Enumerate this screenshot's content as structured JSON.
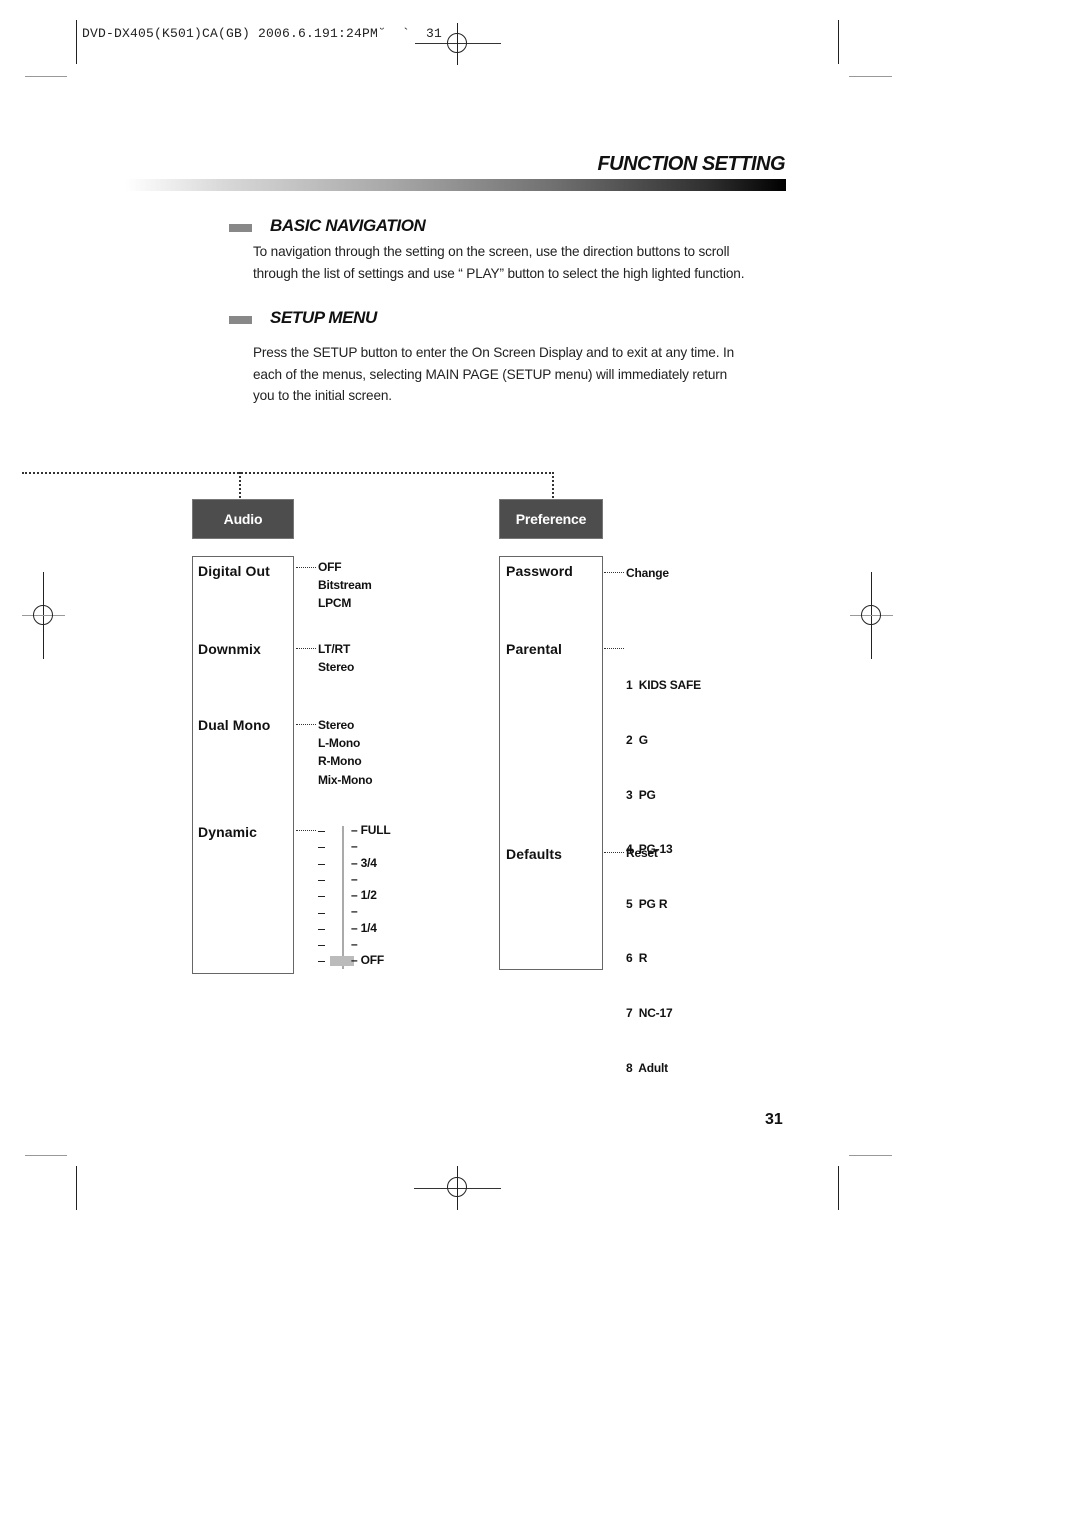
{
  "slug_line": "DVD-DX405(K501)CA(GB) 2006.6.191:24PM˘  `  31",
  "page_title": "FUNCTION SETTING",
  "sections": [
    {
      "title": "BASIC NAVIGATION",
      "lines": [
        "To navigation through the setting on the screen, use the direction buttons to scroll",
        "through the list of settings and use “ PLAY”  button to select the high lighted function."
      ]
    },
    {
      "title": "SETUP MENU",
      "lines": [
        "Press the SETUP button to enter the On Screen Display and to exit at any time. In",
        "each of the menus, selecting MAIN PAGE (SETUP menu) will immediately return",
        "you to the initial screen."
      ]
    }
  ],
  "diagram": {
    "audio": {
      "label": "Audio",
      "items": [
        {
          "label": "Digital Out",
          "options": [
            "OFF",
            "Bitstream",
            "LPCM"
          ]
        },
        {
          "label": "Downmix",
          "options": [
            "LT/RT",
            "Stereo"
          ]
        },
        {
          "label": "Dual Mono",
          "options": [
            "Stereo",
            "L-Mono",
            "R-Mono",
            "Mix-Mono"
          ]
        },
        {
          "label": "Dynamic",
          "slider": {
            "levels": [
              "– FULL",
              "–",
              "– 3/4",
              "–",
              "– 1/2",
              "–",
              "– 1/4",
              "–",
              "– OFF"
            ],
            "current": "OFF",
            "current_fraction": 0
          }
        }
      ]
    },
    "preference": {
      "label": "Preference",
      "items": [
        {
          "label": "Password",
          "options": [
            "Change"
          ]
        },
        {
          "label": "Parental",
          "options": [
            "1  KIDS SAFE",
            "2  G",
            "3  PG",
            "4  PG-13",
            "5  PG R",
            "6  R",
            "7  NC-17",
            "8  Adult"
          ]
        },
        {
          "label": "Defaults",
          "options": [
            "Reset"
          ]
        }
      ]
    }
  },
  "page_number": "31"
}
